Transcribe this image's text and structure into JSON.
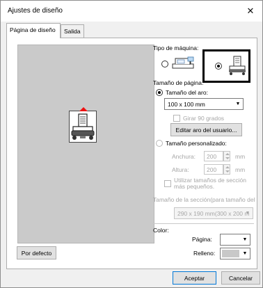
{
  "window": {
    "title": "Ajustes de diseño"
  },
  "icons": {
    "close": "close-icon",
    "machine_flat": "flatbed-machine-icon",
    "machine_cylinder": "cylinder-machine-icon",
    "hoop": "hoop-preview-icon"
  },
  "tabs": [
    {
      "label": "Página de diseño",
      "active": true
    },
    {
      "label": "Salida",
      "active": false
    }
  ],
  "machine": {
    "heading": "Tipo de máquina:",
    "options": [
      {
        "selected": false
      },
      {
        "selected": true
      }
    ]
  },
  "page_size": {
    "heading": "Tamaño de página:",
    "hoop_size_label": "Tamaño del aro:",
    "hoop_size_value": "100 x 100 mm",
    "rotate_label": "Girar 90 grados",
    "edit_user_hoop_label": "Editar aro del usuario...",
    "custom_size_label": "Tamaño personalizado:",
    "width_label": "Anchura:",
    "width_value": "200",
    "height_label": "Altura:",
    "height_value": "200",
    "unit": "mm",
    "use_section_sizes_label": "Utilizar tamaños de sección más pequeños.",
    "section_size_label": "Tamaño de la sección(para tamaño del",
    "section_size_value": "290 x 190 mm(300 x 200 m"
  },
  "color": {
    "heading": "Color:",
    "page_label": "Página:",
    "page_color": "#ffffff",
    "fill_label": "Relleno:",
    "fill_color": "#c8c8c8"
  },
  "buttons": {
    "default": "Por defecto",
    "accept": "Aceptar",
    "cancel": "Cancelar"
  }
}
